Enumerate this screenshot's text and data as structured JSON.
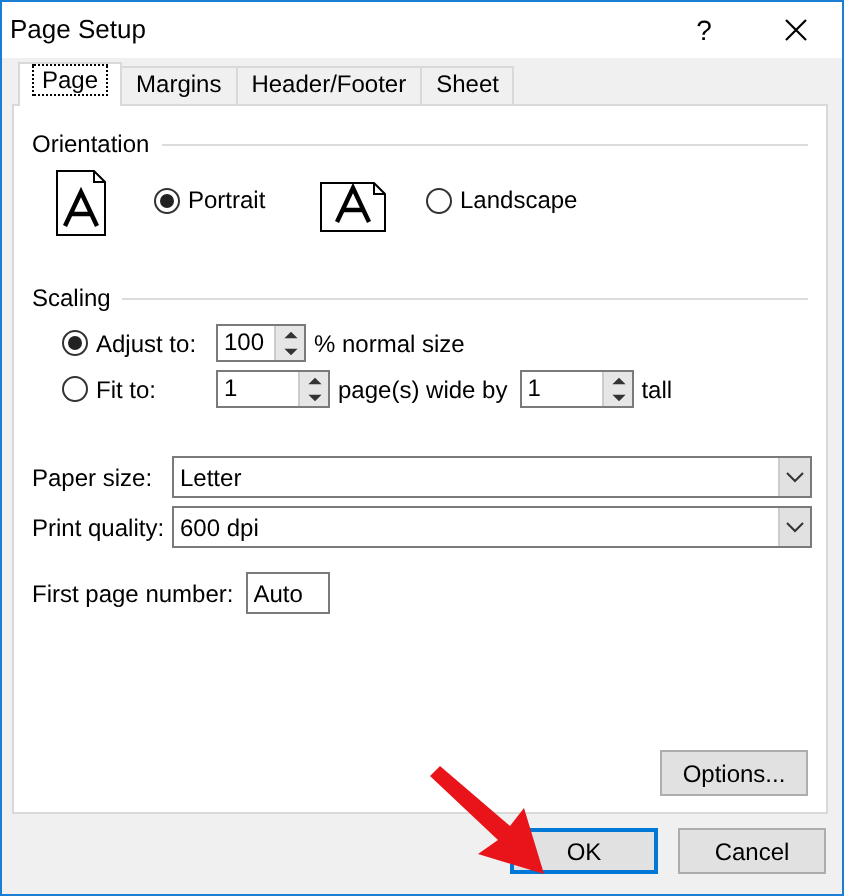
{
  "window": {
    "title": "Page Setup",
    "help": "?"
  },
  "tabs": [
    {
      "label": "Page",
      "selected": true
    },
    {
      "label": "Margins",
      "selected": false
    },
    {
      "label": "Header/Footer",
      "selected": false
    },
    {
      "label": "Sheet",
      "selected": false
    }
  ],
  "orientation": {
    "label": "Orientation",
    "options": [
      {
        "kind": "portrait",
        "label": "Portrait",
        "selected": true
      },
      {
        "kind": "landscape",
        "label": "Landscape",
        "selected": false
      }
    ]
  },
  "scaling": {
    "label": "Scaling",
    "options": [
      {
        "kind": "adjust",
        "label": "Adjust to:",
        "selected": true,
        "value": "100",
        "suffix": "% normal size"
      },
      {
        "kind": "fit",
        "label": "Fit to:",
        "selected": false,
        "value": "1",
        "suffix": "page(s) wide by",
        "tall_value": "1",
        "tall_suffix": "tall"
      }
    ]
  },
  "paper_size": {
    "label": "Paper size:",
    "value": "Letter"
  },
  "print_quality": {
    "label": "Print quality:",
    "value": "600 dpi"
  },
  "first_page_number": {
    "label": "First page number:",
    "value": "Auto"
  },
  "options_button": "Options...",
  "buttons": [
    {
      "label": "OK",
      "focused": true
    },
    {
      "label": "Cancel",
      "focused": false
    }
  ]
}
